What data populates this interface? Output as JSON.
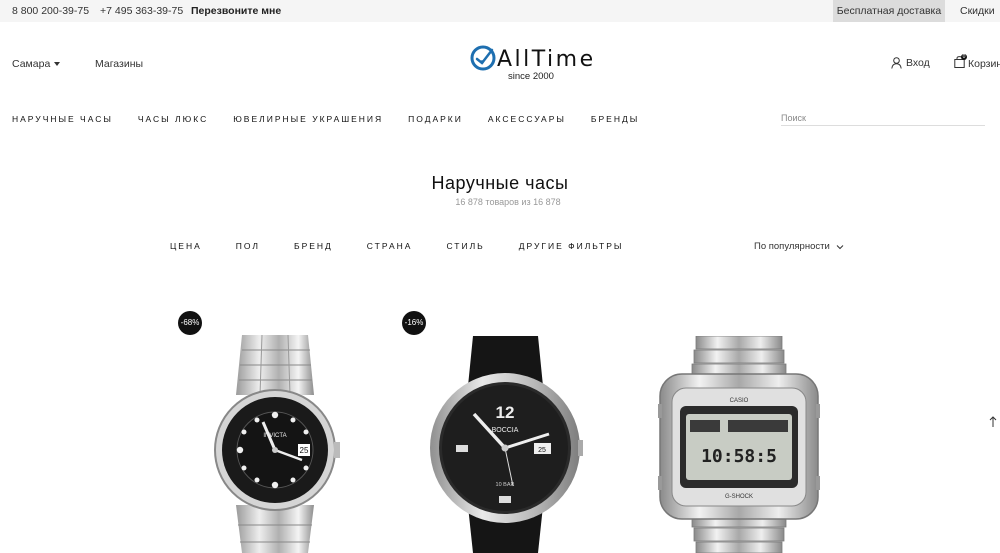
{
  "topbar": {
    "phone1": "8 800 200-39-75",
    "phone2": "+7 495 363-39-75",
    "callback": "Перезвоните мне",
    "delivery": "Бесплатная доставка",
    "discounts": "Скидки"
  },
  "header": {
    "city": "Самара",
    "stores": "Магазины",
    "logo_text": "AllTime",
    "logo_since": "since 2000",
    "login": "Вход",
    "cart": "Корзина",
    "cart_count": "0"
  },
  "nav": {
    "items": [
      "НАРУЧНЫЕ ЧАСЫ",
      "ЧАСЫ ЛЮКС",
      "ЮВЕЛИРНЫЕ УКРАШЕНИЯ",
      "ПОДАРКИ",
      "АКСЕССУАРЫ",
      "БРЕНДЫ"
    ]
  },
  "search": {
    "placeholder": "Поиск"
  },
  "catalog": {
    "title": "Наручные часы",
    "count": "16 878 товаров из 16 878"
  },
  "filters": {
    "items": [
      "ЦЕНА",
      "ПОЛ",
      "БРЕНД",
      "СТРАНА",
      "СТИЛЬ",
      "ДРУГИЕ ФИЛЬТРЫ"
    ],
    "sort": "По популярности"
  },
  "products": [
    {
      "badge": "-68%",
      "brand_text": "INVICTA",
      "date_text": "25"
    },
    {
      "badge": "-16%",
      "brand_text": "BOCCIA",
      "bar_text": "10 BAR",
      "date_text": "25"
    },
    {
      "brand_text": "CASIO",
      "display_text": "10:58:5",
      "sub_text": "G-SHOCK"
    }
  ],
  "colors": {
    "topbar_bg": "#f5f5f5",
    "delivery_bg": "#dcdcdc",
    "logo_blue": "#1e6fb0",
    "badge_bg": "#111111"
  }
}
